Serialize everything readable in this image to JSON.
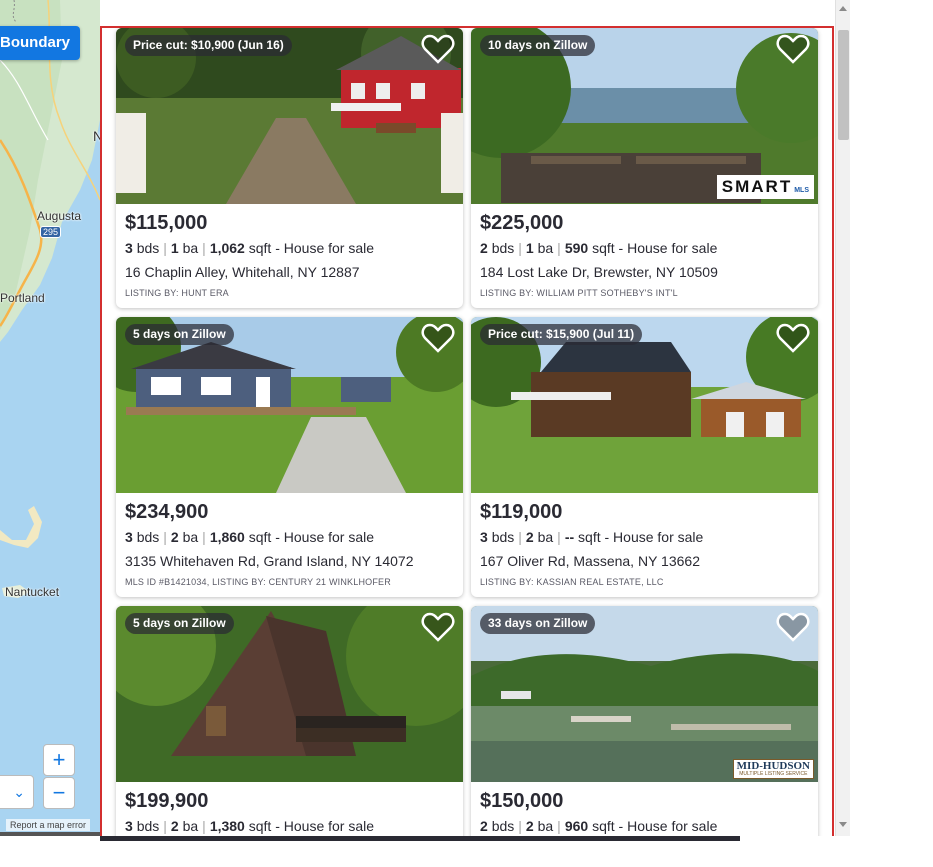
{
  "map": {
    "boundary_label": "Boundary",
    "labels": {
      "augusta": "Augusta",
      "portland": "Portland",
      "nantucket": "Nantucket",
      "edge_letter": "N"
    },
    "highway": "295",
    "zoom_in": "+",
    "zoom_out": "−",
    "report_error": "Report a map error"
  },
  "colors": {
    "accent": "#1277e1",
    "highlight_border": "#d32f2f",
    "text": "#2a2a33",
    "badge_bg": "rgba(42,42,51,.72)"
  },
  "listings": [
    {
      "badge": "Price cut: $10,900 (Jun 16)",
      "price": "$115,000",
      "beds": "3",
      "beds_label": "bds",
      "baths": "1",
      "baths_label": "ba",
      "sqft": "1,062",
      "sqft_label": "sqft",
      "type": "- House for sale",
      "address": "16 Chaplin Alley, Whitehall, NY 12887",
      "agent": "LISTING BY: HUNT ERA",
      "photo": "red-farmhouse"
    },
    {
      "badge": "10 days on Zillow",
      "price": "$225,000",
      "beds": "2",
      "beds_label": "bds",
      "baths": "1",
      "baths_label": "ba",
      "sqft": "590",
      "sqft_label": "sqft",
      "type": "- House for sale",
      "address": "184 Lost Lake Dr, Brewster, NY 10509",
      "agent": "LISTING BY: WILLIAM PITT SOTHEBY'S INT'L",
      "photo": "lake-deck",
      "logo": "SMART",
      "logo_suffix": "MLS"
    },
    {
      "badge": "5 days on Zillow",
      "price": "$234,900",
      "beds": "3",
      "beds_label": "bds",
      "baths": "2",
      "baths_label": "ba",
      "sqft": "1,860",
      "sqft_label": "sqft",
      "type": "- House for sale",
      "address": "3135 Whitehaven Rd, Grand Island, NY 14072",
      "agent": "MLS ID #B1421034, LISTING BY: CENTURY 21 WINKLHOFER",
      "photo": "blue-ranch"
    },
    {
      "badge": "Price cut: $15,900 (Jul 11)",
      "price": "$119,000",
      "beds": "3",
      "beds_label": "bds",
      "baths": "2",
      "baths_label": "ba",
      "sqft": "--",
      "sqft_label": "sqft",
      "type": "- House for sale",
      "address": "167 Oliver Rd, Massena, NY 13662",
      "agent": "LISTING BY: KASSIAN REAL ESTATE, LLC",
      "photo": "log-colonial"
    },
    {
      "badge": "5 days on Zillow",
      "price": "$199,900",
      "beds": "3",
      "beds_label": "bds",
      "baths": "2",
      "baths_label": "ba",
      "sqft": "1,380",
      "sqft_label": "sqft",
      "type": "- House for sale",
      "address": "",
      "agent": "",
      "photo": "a-frame"
    },
    {
      "badge": "33 days on Zillow",
      "price": "$150,000",
      "beds": "2",
      "beds_label": "bds",
      "baths": "2",
      "baths_label": "ba",
      "sqft": "960",
      "sqft_label": "sqft",
      "type": "- House for sale",
      "address": "",
      "agent": "",
      "photo": "lake-view",
      "logo": "MID-HUDSON",
      "logo_suffix": "MULTIPLE LISTING SERVICE"
    }
  ]
}
